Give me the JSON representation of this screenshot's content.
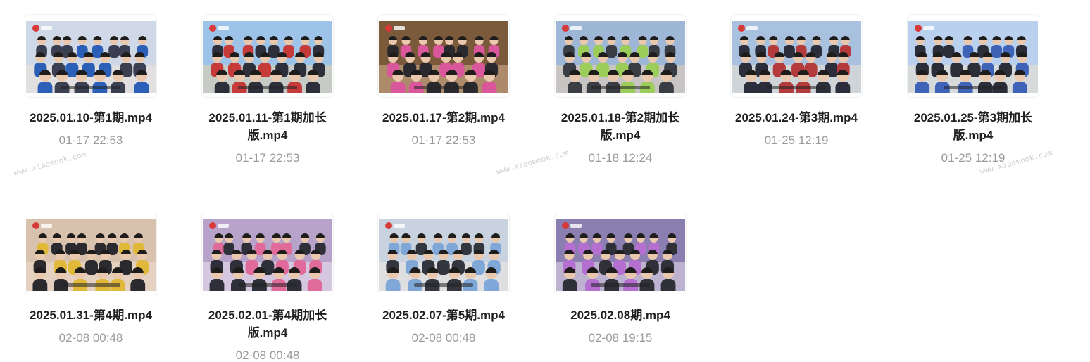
{
  "files": [
    {
      "name": "2025.01.10-第1期.mp4",
      "time": "01-17 22:53"
    },
    {
      "name": "2025.01.11-第1期加长版.mp4",
      "time": "01-17 22:53"
    },
    {
      "name": "2025.01.17-第2期.mp4",
      "time": "01-17 22:53"
    },
    {
      "name": "2025.01.18-第2期加长版.mp4",
      "time": "01-18 12:24"
    },
    {
      "name": "2025.01.24-第3期.mp4",
      "time": "01-25 12:19"
    },
    {
      "name": "2025.01.25-第3期加长版.mp4",
      "time": "01-25 12:19"
    },
    {
      "name": "2025.01.31-第4期.mp4",
      "time": "02-08 00:48"
    },
    {
      "name": "2025.02.01-第4期加长版.mp4",
      "time": "02-08 00:48"
    },
    {
      "name": "2025.02.07-第5期.mp4",
      "time": "02-08 00:48"
    },
    {
      "name": "2025.02.08期.mp4",
      "time": "02-08 19:15"
    }
  ],
  "watermark": "www.xiaomook.com",
  "thumb_palettes": [
    [
      "#cfd8e6",
      "#3a3f52",
      "#f2e6da",
      "#2c5fb8"
    ],
    [
      "#9ec3e8",
      "#2d2f3a",
      "#e8d3a8",
      "#c63a3a"
    ],
    [
      "#7b5a3c",
      "#2a2a2e",
      "#d7b58f",
      "#d9579a"
    ],
    [
      "#9fb7d6",
      "#3b3d45",
      "#e9cfb6",
      "#9ccd5a"
    ],
    [
      "#a9c1df",
      "#2c2f3b",
      "#efe3d2",
      "#b43b3b"
    ],
    [
      "#b9d1ee",
      "#2b2e39",
      "#f1e2cc",
      "#3f63b7"
    ],
    [
      "#d9c2ad",
      "#2b2b2f",
      "#eeded0",
      "#e0b93a"
    ],
    [
      "#b7a3c9",
      "#2e2f38",
      "#efe6f0",
      "#e06a9a"
    ],
    [
      "#c9d3df",
      "#33363f",
      "#f0e8e0",
      "#7fa8d9"
    ],
    [
      "#8a7fb0",
      "#2f3038",
      "#e8dcea",
      "#b46fd0"
    ]
  ]
}
